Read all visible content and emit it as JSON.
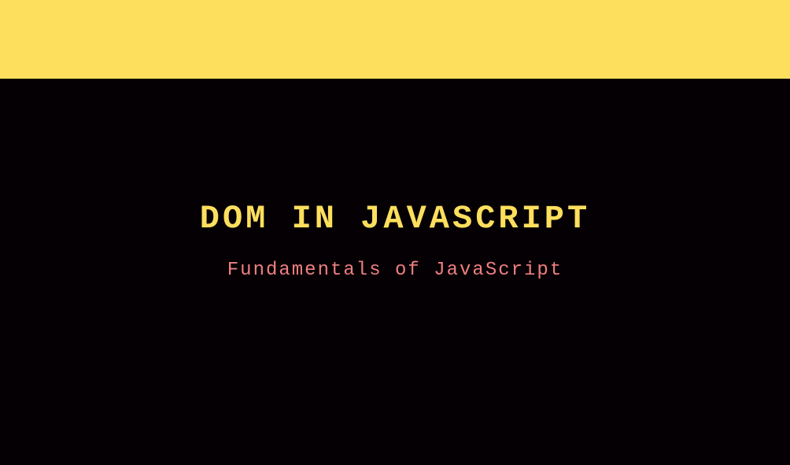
{
  "slide": {
    "title": "DOM IN JAVASCRIPT",
    "subtitle": "Fundamentals of JavaScript"
  },
  "colors": {
    "accent": "#fddf5d",
    "background": "#050004",
    "subtitle": "#ef7f80"
  }
}
